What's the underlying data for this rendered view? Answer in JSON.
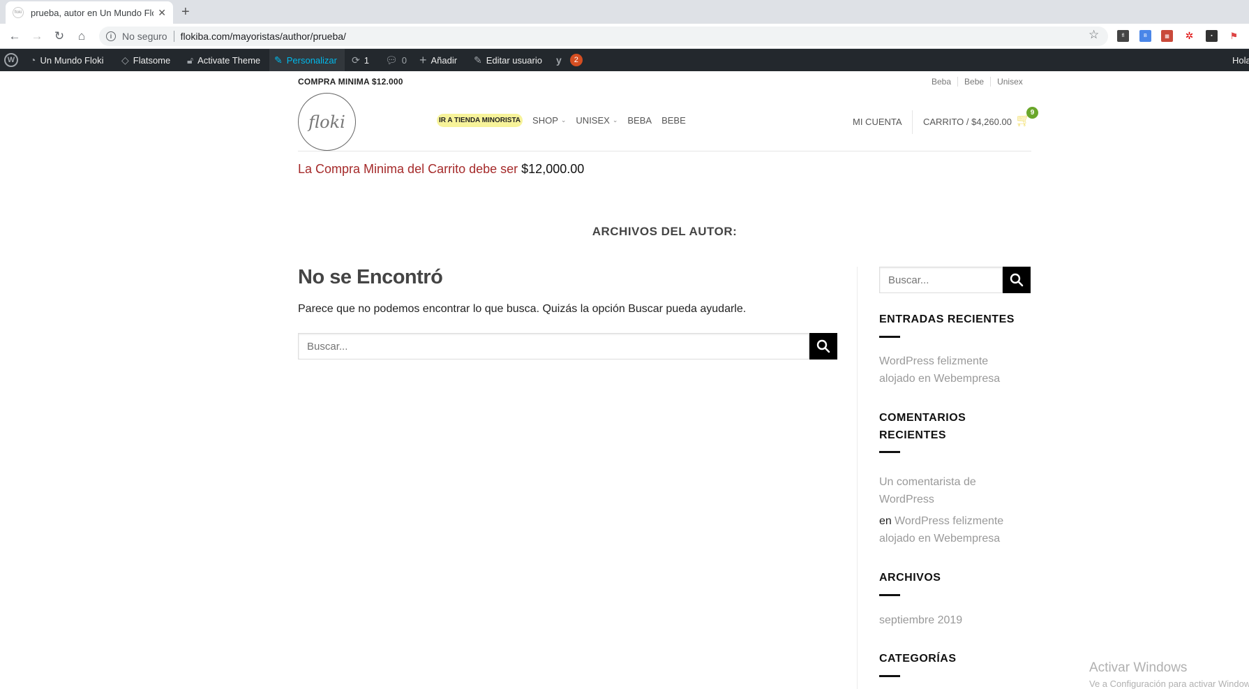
{
  "browser": {
    "tab_title": "prueba, autor en Un Mundo Floki",
    "tab_favicon_text": "floki",
    "new_tab": "+",
    "security_label": "No seguro",
    "url": "flokiba.com/mayoristas/author/prueba/"
  },
  "adminbar": {
    "site_name": "Un Mundo Floki",
    "theme": "Flatsome",
    "activate_theme": "Activate Theme",
    "customize": "Personalizar",
    "updates_count": "1",
    "comments_count": "0",
    "add_new": "Añadir",
    "edit_user": "Editar usuario",
    "yoast_badge": "2",
    "greeting": "Hola"
  },
  "site": {
    "top_notice": "COMPRA MINIMA $12.000",
    "top_links": [
      "Beba",
      "Bebe",
      "Unisex"
    ],
    "logo_text": "floki",
    "nav": {
      "retail_pill": "IR A TIENDA MINORISTA",
      "items": [
        "SHOP",
        "UNISEX",
        "BEBA",
        "BEBE"
      ]
    },
    "account": "MI CUENTA",
    "cart_label": "CARRITO / $4,260.00",
    "cart_count": "9",
    "cart_notice_prefix": "La Compra Minima del Carrito debe ser",
    "cart_notice_amount": "$12,000.00"
  },
  "main": {
    "archive_title": "ARCHIVOS DEL AUTOR:",
    "heading": "No se Encontró",
    "message": "Parece que no podemos encontrar lo que busca. Quizás la opción Buscar pueda ayudarle.",
    "search_placeholder": "Buscar..."
  },
  "sidebar": {
    "search_placeholder": "Buscar...",
    "recent_posts_title": "ENTRADAS RECIENTES",
    "recent_post_line1": "WordPress felizmente",
    "recent_post_line2": "alojado en Webempresa",
    "recent_comments_title_line1": "COMENTARIOS",
    "recent_comments_title_line2": "RECIENTES",
    "comment_author_line1": "Un comentarista de",
    "comment_author_line2": "WordPress",
    "comment_on": "en",
    "comment_post_line1": "WordPress felizmente",
    "comment_post_line2": "alojado en Webempresa",
    "archives_title": "ARCHIVOS",
    "archive_month": "septiembre 2019",
    "categories_title": "CATEGORÍAS"
  },
  "os": {
    "watermark_title": "Activar Windows",
    "watermark_sub": "Ve a Configuración para activar Windows."
  }
}
